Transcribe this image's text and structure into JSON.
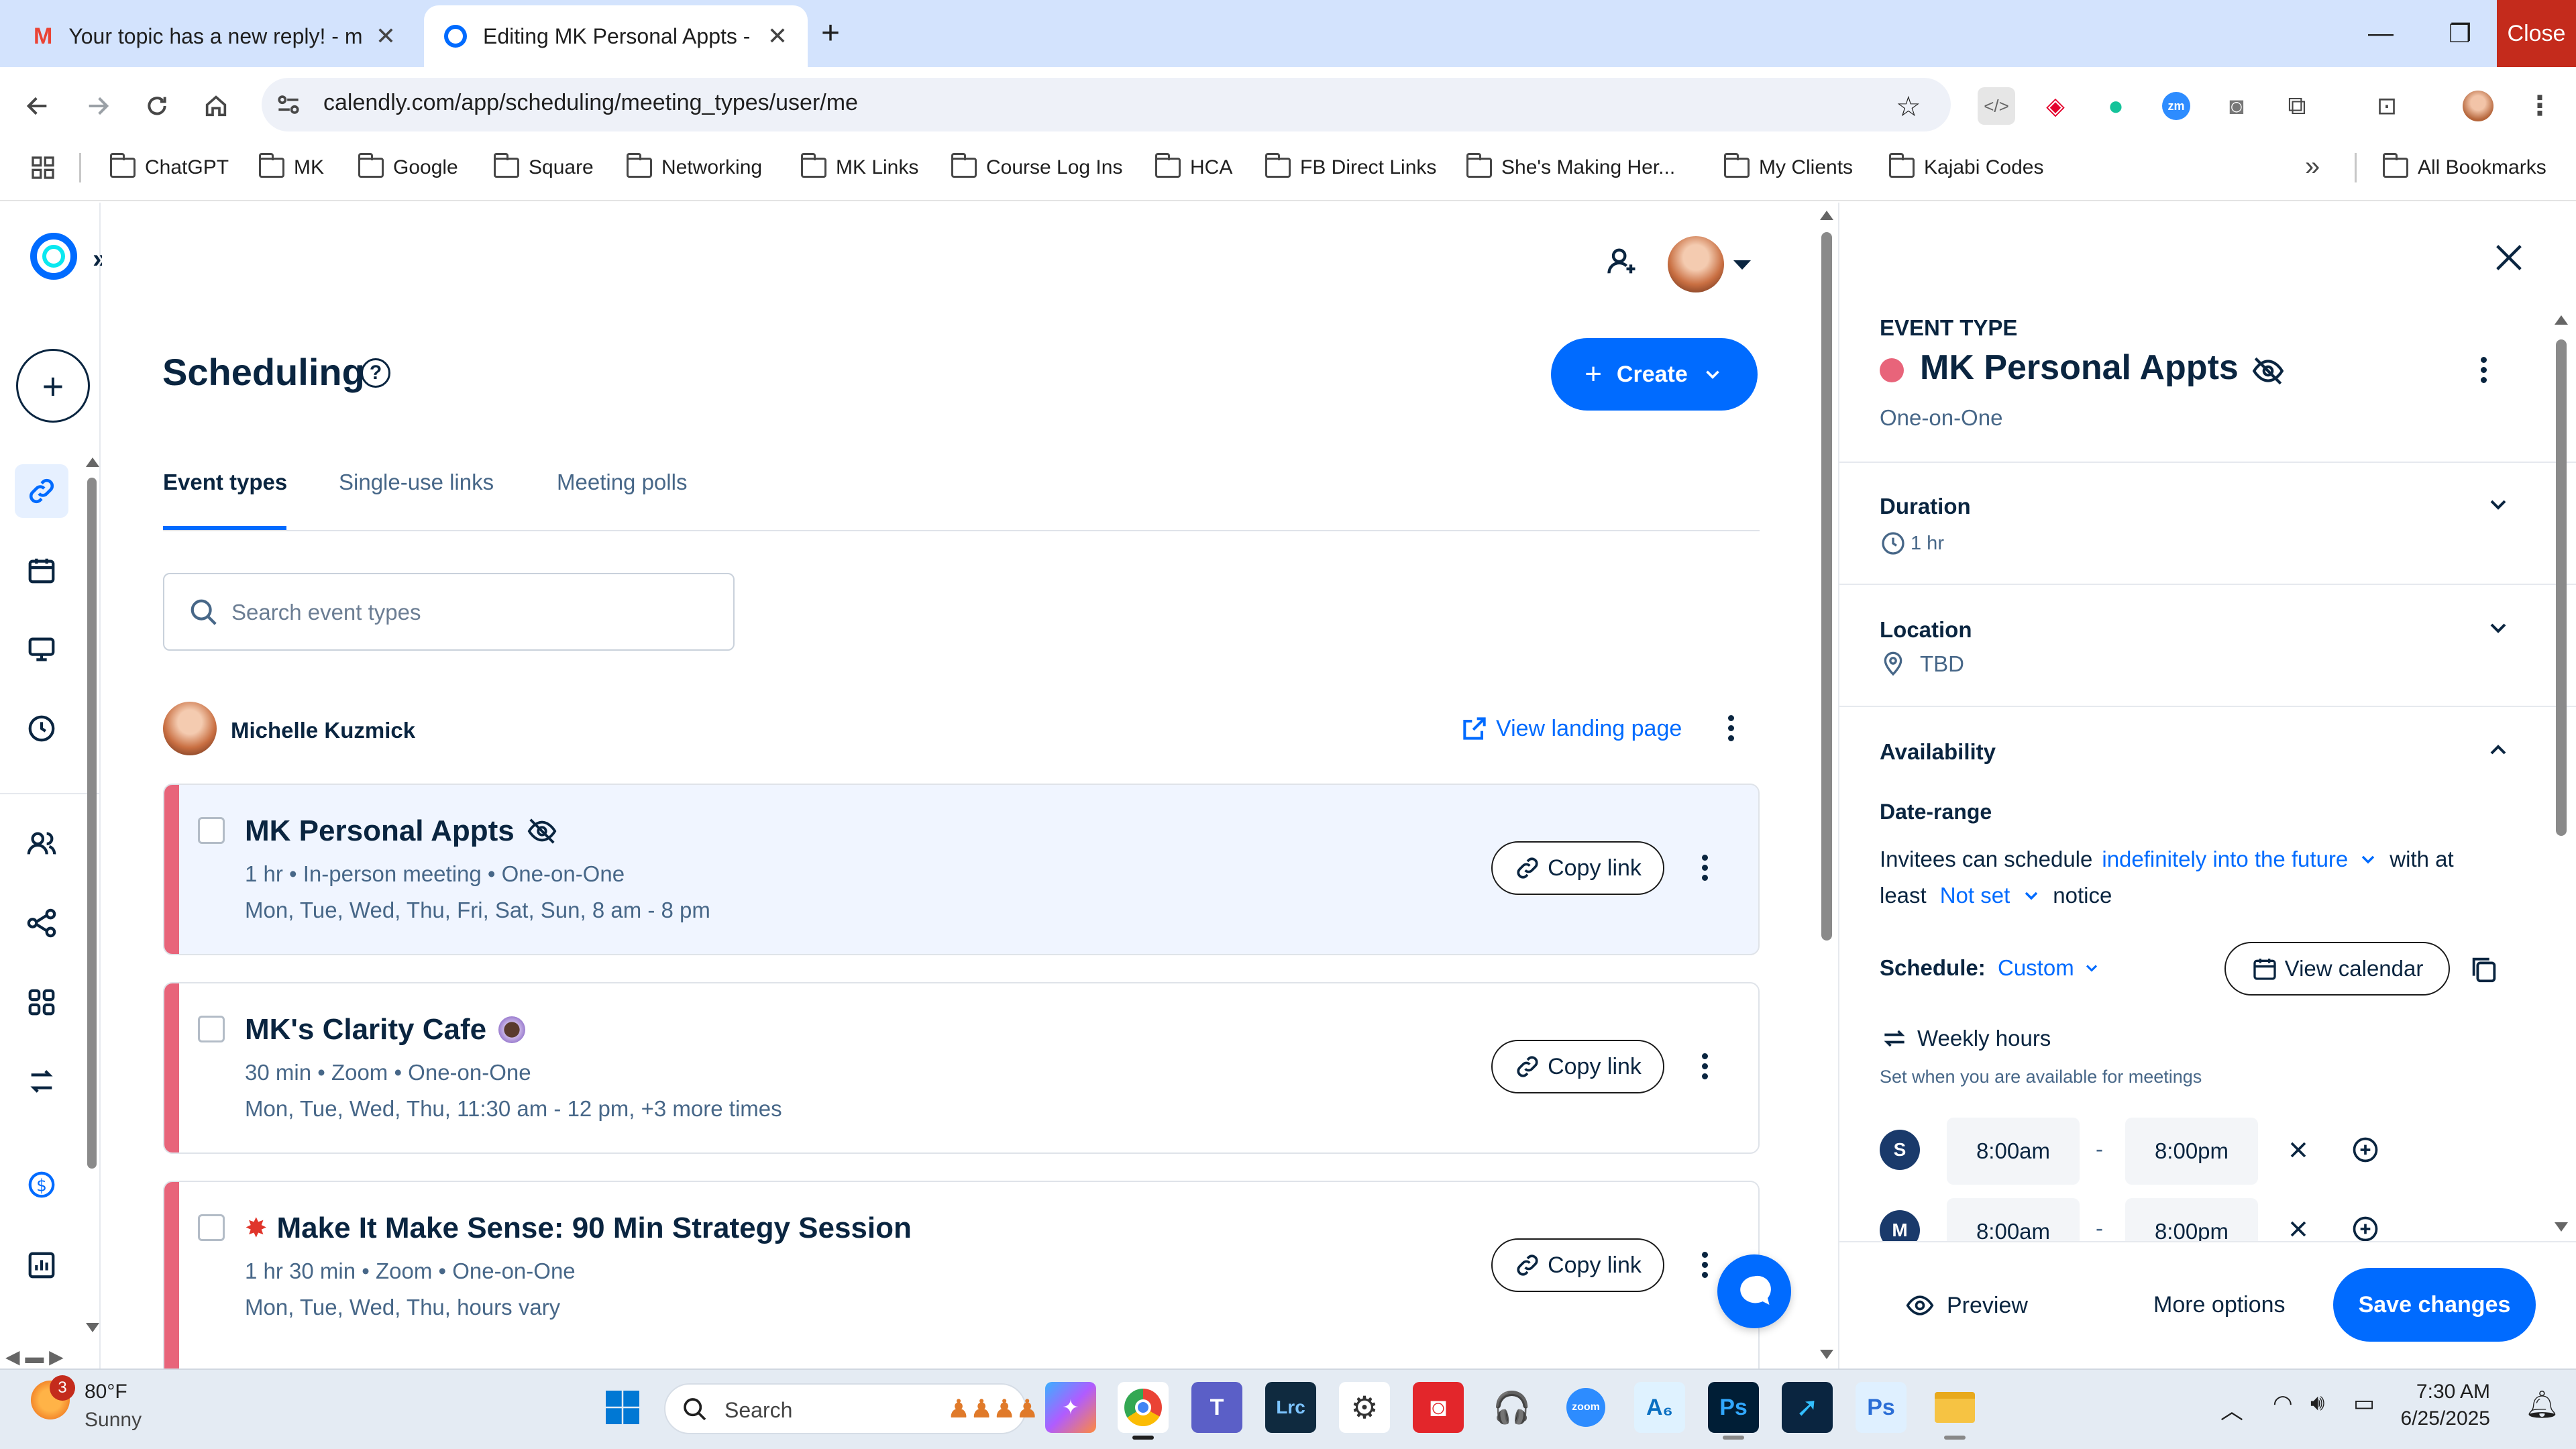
{
  "browser": {
    "tabs": [
      {
        "title": "Your topic has a new reply! - m",
        "icon": "gmail-icon"
      },
      {
        "title": "Editing MK Personal Appts - Ca",
        "icon": "calendly-icon",
        "active": true
      }
    ],
    "close_tooltip": "Close",
    "url": "calendly.com/app/scheduling/meeting_types/user/me",
    "bookmarks": [
      "ChatGPT",
      "MK",
      "Google",
      "Square",
      "Networking",
      "MK Links",
      "Course Log Ins",
      "HCA",
      "FB Direct Links",
      "She's Making Her...",
      "My Clients",
      "Kajabi Codes"
    ],
    "all_bookmarks": "All Bookmarks"
  },
  "page": {
    "title": "Scheduling",
    "create_label": "Create",
    "tabs": [
      "Event types",
      "Single-use links",
      "Meeting polls"
    ],
    "search_placeholder": "Search event types",
    "user_name": "Michelle Kuzmick",
    "view_landing": "View landing page",
    "copy_label": "Copy link",
    "cards": [
      {
        "title": "MK Personal Appts",
        "sub": "1 hr • In-person meeting • One-on-One",
        "days": "Mon, Tue, Wed, Thu, Fri, Sat, Sun, 8 am - 8 pm"
      },
      {
        "title": "MK's Clarity Cafe",
        "sub": "30 min • Zoom • One-on-One",
        "days": "Mon, Tue, Wed, Thu, 11:30 am - 12 pm, +3 more times"
      },
      {
        "title": "Make It Make Sense: 90 Min Strategy Session",
        "sub": "1 hr 30 min • Zoom • One-on-One",
        "days": "Mon, Tue, Wed, Thu, hours vary"
      }
    ]
  },
  "panel": {
    "event_type_label": "EVENT TYPE",
    "event_name": "MK Personal Appts",
    "event_kind": "One-on-One",
    "duration_label": "Duration",
    "duration_value": "1 hr",
    "location_label": "Location",
    "location_value": "TBD",
    "availability_label": "Availability",
    "date_range_label": "Date-range",
    "invitees_text": "Invitees can schedule",
    "range_value": "indefinitely into the future",
    "with_at": "with at",
    "least": "least",
    "notice_value": "Not set",
    "notice": "notice",
    "schedule_label": "Schedule:",
    "schedule_value": "Custom",
    "view_calendar": "View calendar",
    "weekly_hours": "Weekly hours",
    "weekly_sub": "Set when you are available for meetings",
    "rows": [
      {
        "day": "S",
        "start": "8:00am",
        "end": "8:00pm"
      },
      {
        "day": "M",
        "start": "8:00am",
        "end": "8:00pm"
      }
    ],
    "dash": "-",
    "preview": "Preview",
    "more_options": "More options",
    "save": "Save changes"
  },
  "taskbar": {
    "weather_temp": "80°F",
    "weather_desc": "Sunny",
    "weather_badge": "3",
    "search": "Search",
    "time": "7:30 AM",
    "date": "6/25/2025"
  },
  "colors": {
    "brand": "#006bff",
    "event_pink": "#e8647a",
    "navy": "#0a2540"
  }
}
